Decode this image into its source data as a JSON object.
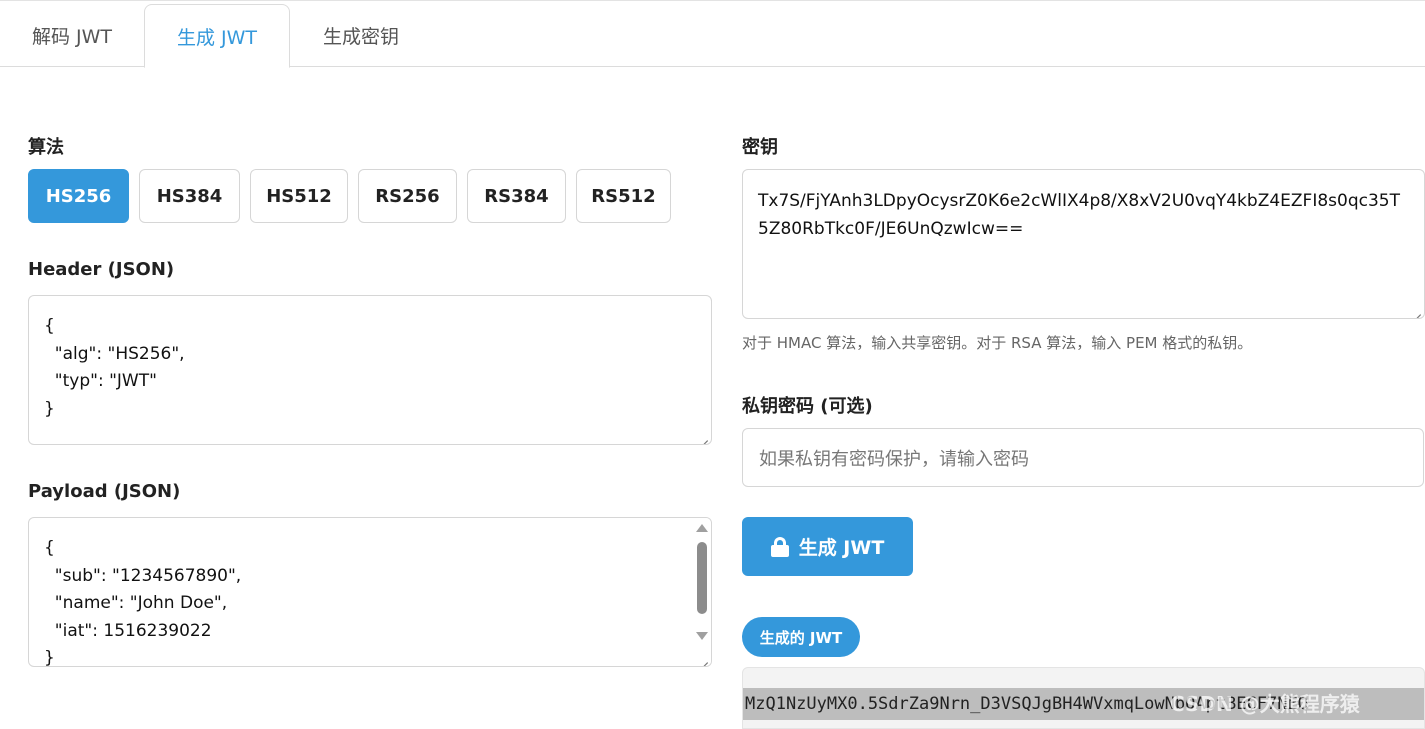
{
  "tabs": [
    {
      "label": "解码 JWT"
    },
    {
      "label": "生成 JWT"
    },
    {
      "label": "生成密钥"
    }
  ],
  "algorithm": {
    "label": "算法",
    "options": [
      "HS256",
      "HS384",
      "HS512",
      "RS256",
      "RS384",
      "RS512"
    ],
    "selected": "HS256"
  },
  "header": {
    "label": "Header (JSON)",
    "value": "{\n  \"alg\": \"HS256\",\n  \"typ\": \"JWT\"\n}"
  },
  "payload": {
    "label": "Payload (JSON)",
    "value": "{\n  \"sub\": \"1234567890\",\n  \"name\": \"John Doe\",\n  \"iat\": 1516239022\n}"
  },
  "secret": {
    "label": "密钥",
    "value": "Tx7S/FjYAnh3LDpyOcysrZ0K6e2cWlIX4p8/X8xV2U0vqY4kbZ4EZFI8s0qc35T5Z80RbTkc0F/JE6UnQzwIcw==",
    "hint": "对于 HMAC 算法，输入共享密钥。对于 RSA 算法，输入 PEM 格式的私钥。"
  },
  "passphrase": {
    "label": "私钥密码 (可选)",
    "placeholder": "如果私钥有密码保护，请输入密码"
  },
  "generate_button": {
    "label": "生成 JWT",
    "icon": "lock-icon"
  },
  "result": {
    "badge": "生成的 JWT",
    "value": "MzQ1NzUyMX0.5SdrZa9Nrn_D3VSQJgBH4WVxmqLowNbOAptBECF7NEQ"
  },
  "watermark": "CSDN @大熊程序猿",
  "colors": {
    "accent": "#3498db",
    "border": "#d6d6d6",
    "hint_text": "#666666"
  }
}
